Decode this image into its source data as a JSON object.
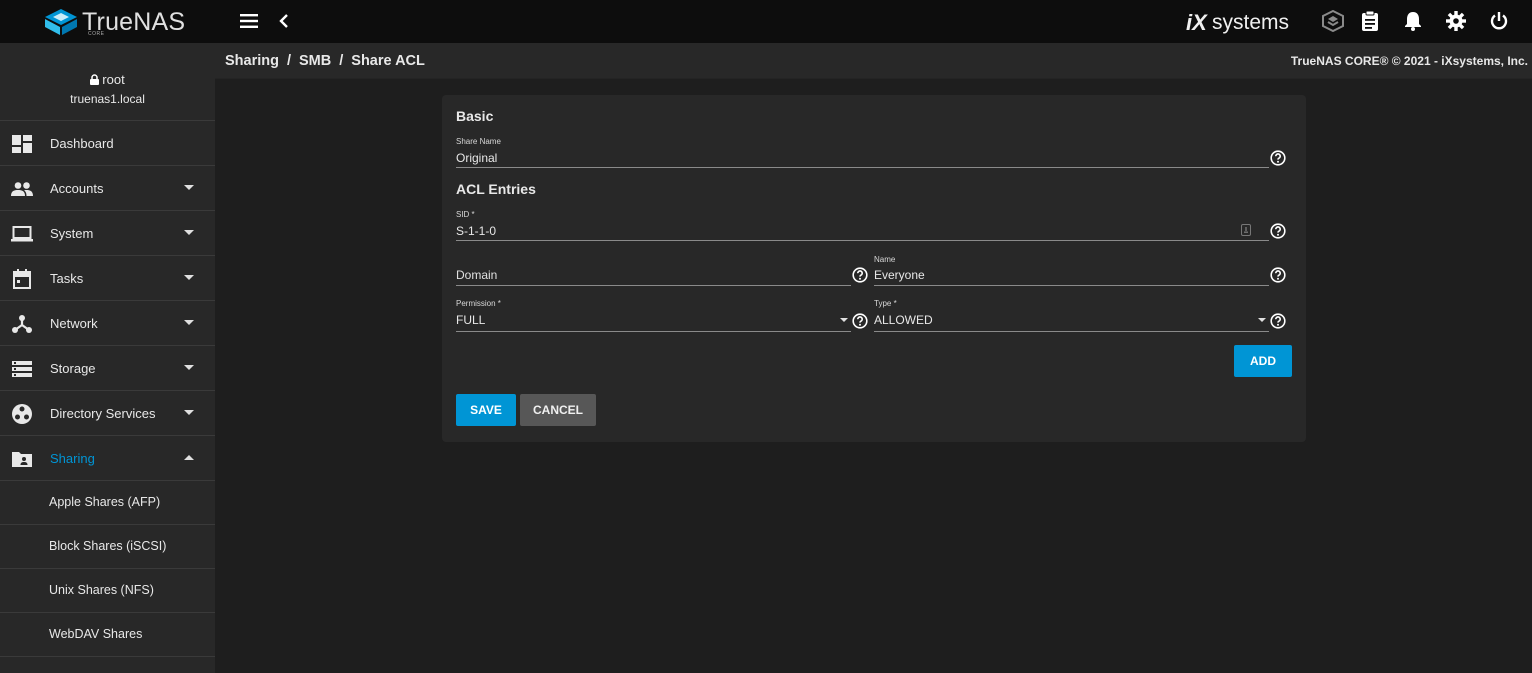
{
  "brand": {
    "name": "TrueNAS",
    "edition": "CORE",
    "vendor_prefix": "iX",
    "vendor_suffix": "systems"
  },
  "topbar": {
    "icons": [
      "menu-icon",
      "chevron-left-icon",
      "truecommand-icon",
      "clipboard-icon",
      "bell-icon",
      "gear-icon",
      "power-icon"
    ]
  },
  "user": {
    "name": "root",
    "host": "truenas1.local"
  },
  "sidebar": {
    "items": [
      {
        "label": "Dashboard"
      },
      {
        "label": "Accounts"
      },
      {
        "label": "System"
      },
      {
        "label": "Tasks"
      },
      {
        "label": "Network"
      },
      {
        "label": "Storage"
      },
      {
        "label": "Directory Services"
      },
      {
        "label": "Sharing"
      }
    ],
    "sub_items": [
      {
        "label": "Apple Shares (AFP)"
      },
      {
        "label": "Block Shares (iSCSI)"
      },
      {
        "label": "Unix Shares (NFS)"
      },
      {
        "label": "WebDAV Shares"
      }
    ]
  },
  "breadcrumb": {
    "items": [
      "Sharing",
      "SMB",
      "Share ACL"
    ],
    "separator": "/"
  },
  "copyright": "TrueNAS CORE® © 2021 - iXsystems, Inc.",
  "form": {
    "basic_title": "Basic",
    "share_name": {
      "label": "Share Name",
      "value": "Original"
    },
    "acl_title": "ACL Entries",
    "sid": {
      "label": "SID *",
      "value": "S-1-1-0"
    },
    "domain": {
      "placeholder": "Domain",
      "value": ""
    },
    "name": {
      "label": "Name",
      "value": "Everyone"
    },
    "permission": {
      "label": "Permission *",
      "value": "FULL"
    },
    "type": {
      "label": "Type *",
      "value": "ALLOWED"
    },
    "add_label": "ADD",
    "save_label": "SAVE",
    "cancel_label": "CANCEL"
  },
  "colors": {
    "accent": "#0095d5",
    "topbar": "#0d0d0d",
    "sidebar": "#282828",
    "background": "#1e1e1e"
  }
}
